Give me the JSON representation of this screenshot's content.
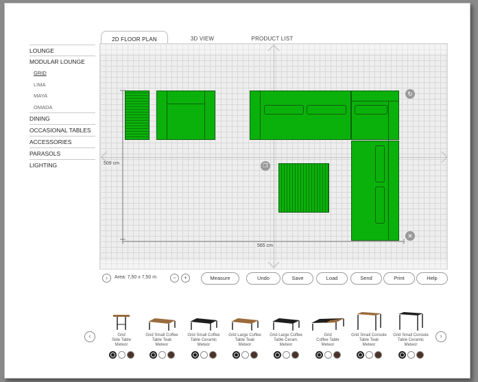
{
  "tabs": [
    "2D FLOOR PLAN",
    "3D VIEW",
    "PRODUCT LIST"
  ],
  "sidebar": {
    "items": [
      {
        "label": "LOUNGE"
      },
      {
        "label": "MODULAR LOUNGE"
      }
    ],
    "subitems": [
      "GRID",
      "LIMA",
      "MAYA",
      "OMADA"
    ],
    "items2": [
      "DINING",
      "OCCASIONAL TABLES",
      "ACCESSORIES",
      "PARASOLS",
      "LIGHTING"
    ]
  },
  "plan": {
    "dim_height": "509 cm",
    "dim_width": "565 cm",
    "colors": {
      "furniture": "#0bb10b",
      "furniture_outline": "#0c5f0c",
      "grid": "#d8d8d8"
    }
  },
  "toolbar": {
    "area_label": "Area: 7,50 x 7,50 m",
    "buttons": [
      "Measure",
      "Undo",
      "Save",
      "Load",
      "Send",
      "Print",
      "Help"
    ]
  },
  "products": [
    {
      "name": "Grid\nSide Table\nMeteor",
      "kind": "side-table"
    },
    {
      "name": "Grid Small Coffee\nTable Teak\nMeteor",
      "kind": "coffee-teak"
    },
    {
      "name": "Grid Small Coffee\nTable Ceramic\nMeteor",
      "kind": "coffee-dark"
    },
    {
      "name": "Grid Large Coffee\nTable Teak\nMeteor",
      "kind": "coffee-teak"
    },
    {
      "name": "Grid Large Coffee\nTable Ceram.\nMeteor",
      "kind": "coffee-dark"
    },
    {
      "name": "Grid\nCoffee Table\nMeteor",
      "kind": "coffee-mixed"
    },
    {
      "name": "Grid Small Console\nTable Teak\nMeteor",
      "kind": "console-teak"
    },
    {
      "name": "Grid Small Console\nTable Ceramic\nMeteor",
      "kind": "console-dark"
    }
  ],
  "swatch_colors": [
    "#1a1a1a",
    "#ffffff",
    "#4a3228"
  ]
}
